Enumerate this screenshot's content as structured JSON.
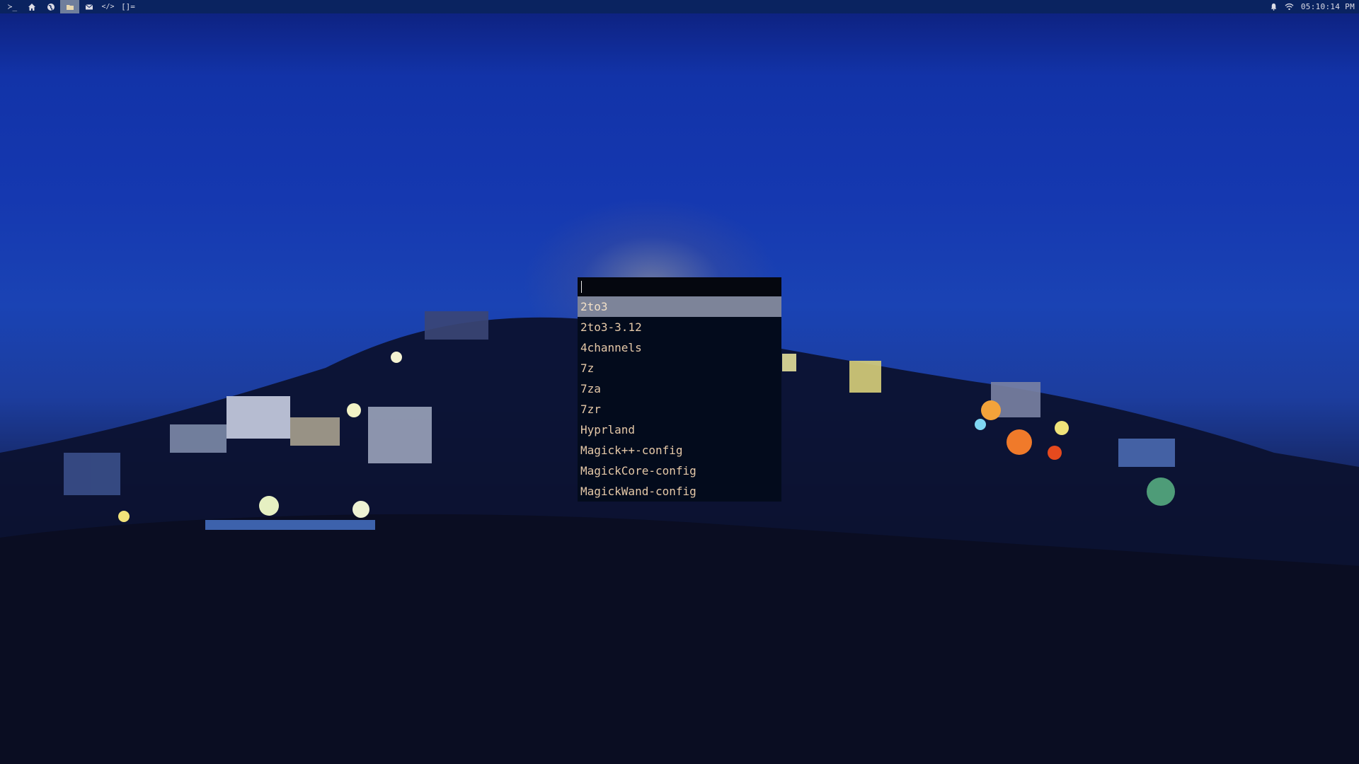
{
  "topbar": {
    "icons": [
      {
        "name": "terminal-icon",
        "glyph": "≻_",
        "active": false
      },
      {
        "name": "home-icon",
        "glyph": "home",
        "active": false
      },
      {
        "name": "globe-icon",
        "glyph": "globe",
        "active": false
      },
      {
        "name": "folder-icon",
        "glyph": "folder",
        "active": true
      },
      {
        "name": "mail-icon",
        "glyph": "mail",
        "active": false
      },
      {
        "name": "code-icon",
        "glyph": "</>",
        "active": false
      }
    ],
    "layout_indicator": "[]=",
    "clock": "05:10:14 PM"
  },
  "launcher": {
    "input_value": "",
    "items": [
      "2to3",
      "2to3-3.12",
      "4channels",
      "7z",
      "7za",
      "7zr",
      "Hyprland",
      "Magick++-config",
      "MagickCore-config",
      "MagickWand-config"
    ],
    "selected_index": 0
  },
  "colors": {
    "topbar_bg": "#0a2360",
    "active_tag_bg": "#6f7e9c",
    "launcher_bg": "#04091a",
    "launcher_text": "#e6c9a8",
    "selected_bg": "#7d8499"
  }
}
